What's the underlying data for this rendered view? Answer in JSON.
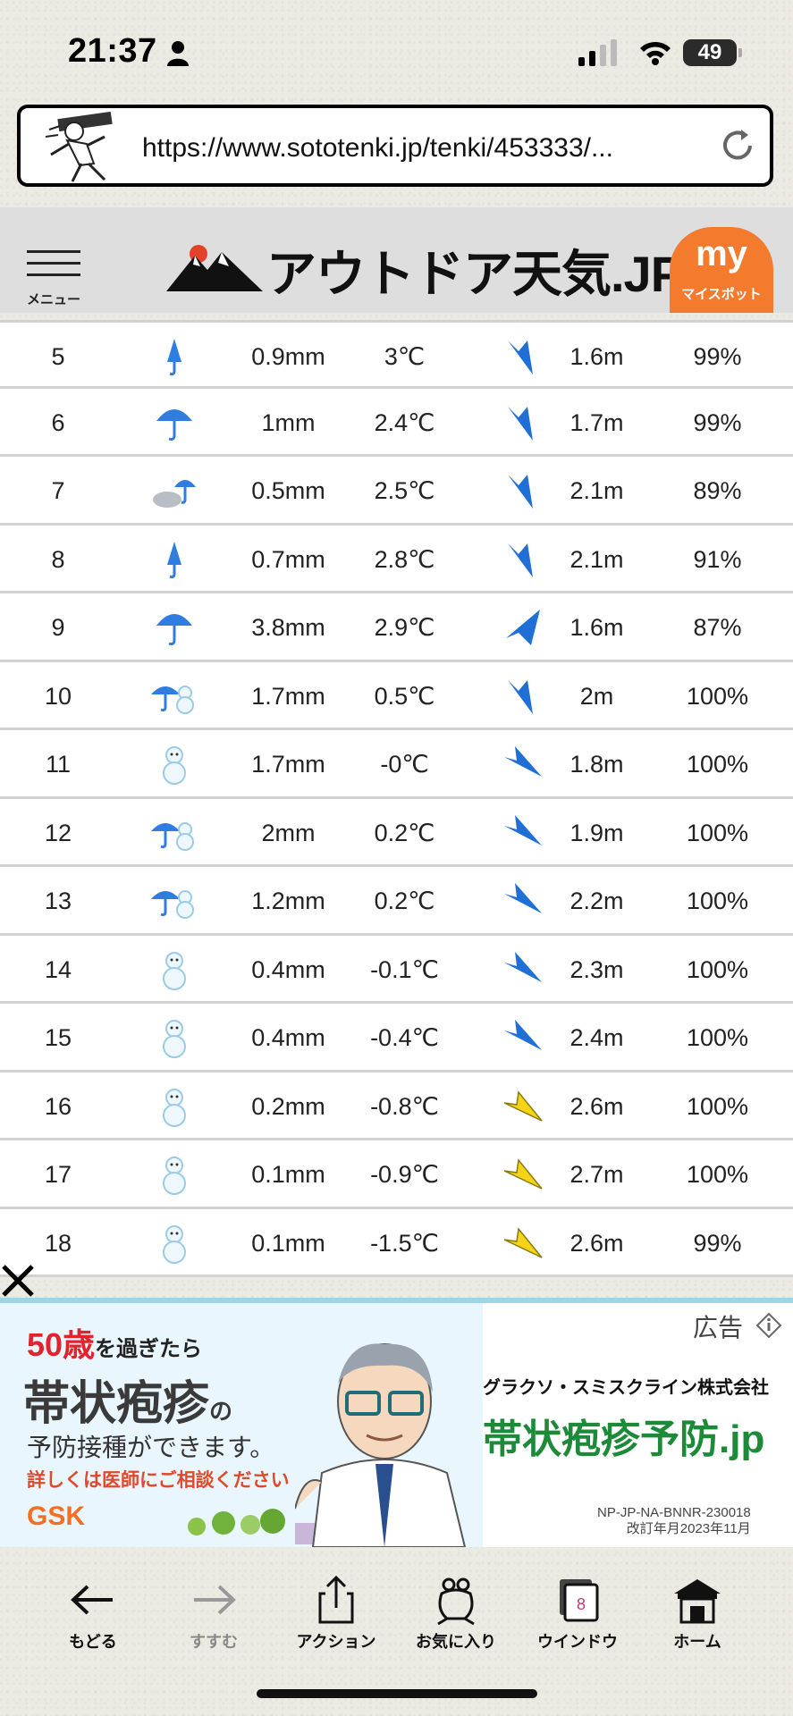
{
  "status_bar": {
    "time": "21:37",
    "battery": "49"
  },
  "browser": {
    "url": "https://www.sototenki.jp/tenki/453333/..."
  },
  "site_header": {
    "menu_label": "メニュー",
    "logo_text": "アウトドア天気.JP",
    "myspot_big": "my",
    "myspot_label": "マイスポット"
  },
  "forecast": {
    "rows": [
      {
        "hour": "5",
        "weather": "umbrella-closed",
        "rain": "0.9mm",
        "temp": "3℃",
        "wind_dir": "blue-down",
        "wind": "1.6m",
        "humidity": "99%"
      },
      {
        "hour": "6",
        "weather": "umbrella",
        "rain": "1mm",
        "temp": "2.4℃",
        "wind_dir": "blue-down",
        "wind": "1.7m",
        "humidity": "99%"
      },
      {
        "hour": "7",
        "weather": "cloud-umbrella",
        "rain": "0.5mm",
        "temp": "2.5℃",
        "wind_dir": "blue-down",
        "wind": "2.1m",
        "humidity": "89%"
      },
      {
        "hour": "8",
        "weather": "umbrella-closed",
        "rain": "0.7mm",
        "temp": "2.8℃",
        "wind_dir": "blue-down",
        "wind": "2.1m",
        "humidity": "91%"
      },
      {
        "hour": "9",
        "weather": "umbrella",
        "rain": "3.8mm",
        "temp": "2.9℃",
        "wind_dir": "blue-upleft",
        "wind": "1.6m",
        "humidity": "87%"
      },
      {
        "hour": "10",
        "weather": "umbrella-snowman",
        "rain": "1.7mm",
        "temp": "0.5℃",
        "wind_dir": "blue-down",
        "wind": "2m",
        "humidity": "100%"
      },
      {
        "hour": "11",
        "weather": "snowman",
        "rain": "1.7mm",
        "temp": "-0℃",
        "wind_dir": "blue-right",
        "wind": "1.8m",
        "humidity": "100%"
      },
      {
        "hour": "12",
        "weather": "umbrella-snowman",
        "rain": "2mm",
        "temp": "0.2℃",
        "wind_dir": "blue-right",
        "wind": "1.9m",
        "humidity": "100%"
      },
      {
        "hour": "13",
        "weather": "umbrella-snowman",
        "rain": "1.2mm",
        "temp": "0.2℃",
        "wind_dir": "blue-right",
        "wind": "2.2m",
        "humidity": "100%"
      },
      {
        "hour": "14",
        "weather": "snowman",
        "rain": "0.4mm",
        "temp": "-0.1℃",
        "wind_dir": "blue-right",
        "wind": "2.3m",
        "humidity": "100%"
      },
      {
        "hour": "15",
        "weather": "snowman",
        "rain": "0.4mm",
        "temp": "-0.4℃",
        "wind_dir": "blue-right",
        "wind": "2.4m",
        "humidity": "100%"
      },
      {
        "hour": "16",
        "weather": "snowman",
        "rain": "0.2mm",
        "temp": "-0.8℃",
        "wind_dir": "yellow-right",
        "wind": "2.6m",
        "humidity": "100%"
      },
      {
        "hour": "17",
        "weather": "snowman",
        "rain": "0.1mm",
        "temp": "-0.9℃",
        "wind_dir": "yellow-right",
        "wind": "2.7m",
        "humidity": "100%"
      },
      {
        "hour": "18",
        "weather": "snowman",
        "rain": "0.1mm",
        "temp": "-1.5℃",
        "wind_dir": "yellow-right",
        "wind": "2.6m",
        "humidity": "99%"
      }
    ]
  },
  "ad": {
    "label": "広告",
    "age_line": "50歳",
    "age_suffix": "を過ぎたら",
    "headline": "帯状疱疹",
    "headline_suffix": "の",
    "sub": "予防接種ができます。",
    "note": "詳しくは医師にご相談ください",
    "brand": "GSK",
    "company": "グラクソ・スミスクライン株式会社",
    "domain": "帯状疱疹予防.jp",
    "code1": "NP-JP-NA-BNNR-230018",
    "code2": "改訂年月2023年11月"
  },
  "toolbar": {
    "back": "もどる",
    "forward": "すすむ",
    "action": "アクション",
    "favorites": "お気に入り",
    "window": "ウインドウ",
    "window_count": "8",
    "home": "ホーム"
  },
  "colors": {
    "accent_orange": "#f47a2e",
    "wind_blue": "#1f6fd6",
    "wind_yellow": "#f5d418",
    "ad_red": "#e0232d",
    "ad_green": "#1d8a3a"
  }
}
